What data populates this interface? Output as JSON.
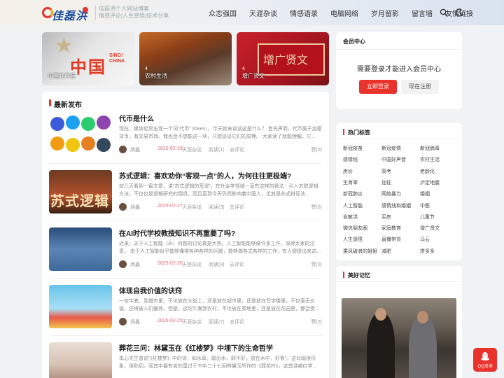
{
  "header": {
    "logo_text": "佳磊洪",
    "tagline": [
      "佳磊洪个人网站博客",
      "情感评论|人生感悟|技术分享"
    ],
    "nav": [
      "众志强国",
      "天涯杂谈",
      "情感语录",
      "电脑网络",
      "岁月留影",
      "留言墙",
      "友情链接"
    ]
  },
  "cards": [
    {
      "label": "中国好声音",
      "count": "",
      "art_big": "中国",
      "art_big2": "好声音",
      "art_small": "SING! CHINA"
    },
    {
      "label": "农村生活",
      "count": "4"
    },
    {
      "label": "增广贤文",
      "count": "4",
      "art_title": "增广贤文"
    }
  ],
  "latest": {
    "title": "最新发布",
    "posts": [
      {
        "title": "代币是什么",
        "excerpt": "现在，媒体经常出现一个词“代币”（token），今天就来谈谈这是什么？ 首先声明，代币属于加密货币，有交易市场。我也会不想能这一块，只想谈谈它们的原理。 大家读了就能理解，它…",
        "author": "炳鑫",
        "date": "2025-02-28",
        "category": "天涯杂谈",
        "reads": "阅读(1)",
        "comments": "去评论",
        "likes": "赞(0)"
      },
      {
        "title": "苏式逻辑：喜欢劝你“客观一点”的人，为何往往更极端?",
        "excerpt": "前几天看到一篇文章，讲“苏式逻辑的荒谬”。在社会学领域一直有这样的看法：引入苏联逻辑方法，不仅仅是逻辑研究的倒退，而且直到今天仍然影响着中国人，尤其是苏式辩证法…",
        "author": "炳鑫",
        "date": "2025-02-27",
        "category": "天涯杂谈",
        "reads": "阅读(3)",
        "comments": "去评论",
        "likes": "赞(0)",
        "thumb_text": "苏式逻辑"
      },
      {
        "title": "在AI时代学校教授知识不再重要了吗?",
        "excerpt": "近来，关于人工智能（AI）问题的讨论真是大热。人工智能能够做许多工作，深得大家的注意。 由于人工智能似乎能够懂得各种各样的问题，能够做各式各样的工作，有人便提出来这…",
        "author": "炳鑫",
        "date": "2025-02-26",
        "category": "天涯杂谈",
        "reads": "阅读(8)",
        "comments": "去评论",
        "likes": "赞(0)"
      },
      {
        "title": "体现自我价值的诀窍",
        "excerpt": "一坨牛粪，到城市里，不论放在大街上，还是放在超市里，还是放在写字楼里，不仅毫无价值，还将被人们嫌弃。但是，这坨牛粪到农村，不论放在菜地里，还是放在花园里，都会受…",
        "author": "炳鑫",
        "date": "2025-02-25",
        "category": "天涯杂谈",
        "reads": "阅读(7)",
        "comments": "去评论",
        "likes": "赞(0)"
      },
      {
        "title": "葬花三问：林黛玉在《红楼梦》中埋下的生命哲学",
        "excerpt": "本心先生曾说“《红楼梦》中的诗，如水草。取出水，即不好。放在水中，好看”。这比喻很形象，很贴切。而其中最有名的莫过于书中二十七回林黛玉所作的《葬花吟》，这首诗被红学…",
        "author": "炳鑫",
        "date": "",
        "category": "",
        "reads": "",
        "comments": "",
        "likes": ""
      }
    ]
  },
  "member": {
    "title": "会员中心",
    "message": "需要登录才能进入会员中心",
    "login": "立即登录",
    "register": "现在注册"
  },
  "tags": {
    "title": "热门标签",
    "items": [
      "新冠疫苗",
      "新冠疫情",
      "新冠病毒",
      "感情线",
      "中国好声音",
      "农村生活",
      "房价",
      "高考",
      "老龄化",
      "生育率",
      "加征",
      "泸定地震",
      "新冠肺炎",
      "网络暴力",
      "婚姻",
      "人工智能",
      "感情线和婚姻",
      "中医",
      "俞敏洪",
      "买房",
      "儿童节",
      "微信朋友圈",
      "家庭教育",
      "增广贤文",
      "人生感悟",
      "直播带货",
      "马云",
      "乘风破浪的姐姐",
      "减肥",
      "拼多多"
    ]
  },
  "memory": {
    "title": "美好记忆"
  },
  "qq": {
    "label": "QQ咨询"
  },
  "colors": {
    "accent": "#e8322b",
    "date": "#e86a78"
  }
}
